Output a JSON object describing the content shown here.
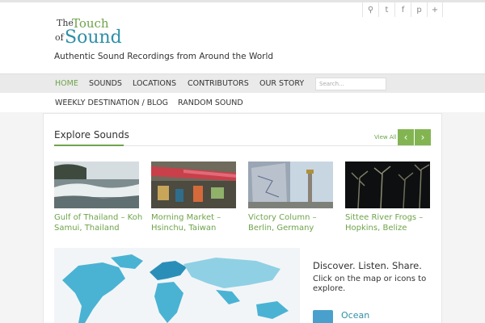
{
  "header": {
    "social_icons": [
      "search-icon",
      "twitter-icon",
      "facebook-icon",
      "pinterest-icon",
      "plus-icon"
    ],
    "logo": {
      "the": "The",
      "touch": "Touch",
      "of": "of",
      "sound": "Sound"
    },
    "tagline": "Authentic Sound Recordings from Around the World"
  },
  "nav": {
    "primary": [
      "HOME",
      "SOUNDS",
      "LOCATIONS",
      "CONTRIBUTORS",
      "OUR STORY"
    ],
    "search_placeholder": "Search...",
    "secondary": [
      "WEEKLY DESTINATION / BLOG",
      "RANDOM SOUND"
    ]
  },
  "explore": {
    "title": "Explore Sounds",
    "view_all": "View All",
    "items": [
      {
        "caption": "Gulf of Thailand – Koh Samui, Thailand"
      },
      {
        "caption": "Morning Market – Hsinchu, Taiwan"
      },
      {
        "caption": "Victory Column – Berlin, Germany"
      },
      {
        "caption": "Sittee River Frogs – Hopkins, Belize"
      }
    ]
  },
  "discover": {
    "heading": "Discover. Listen. Share.",
    "text": "Click on the map or icons to explore.",
    "category": "Ocean"
  },
  "colors": {
    "accent_green": "#6ea34a",
    "accent_blue": "#2e8fa8",
    "map_blue": "#4ab3d4"
  }
}
